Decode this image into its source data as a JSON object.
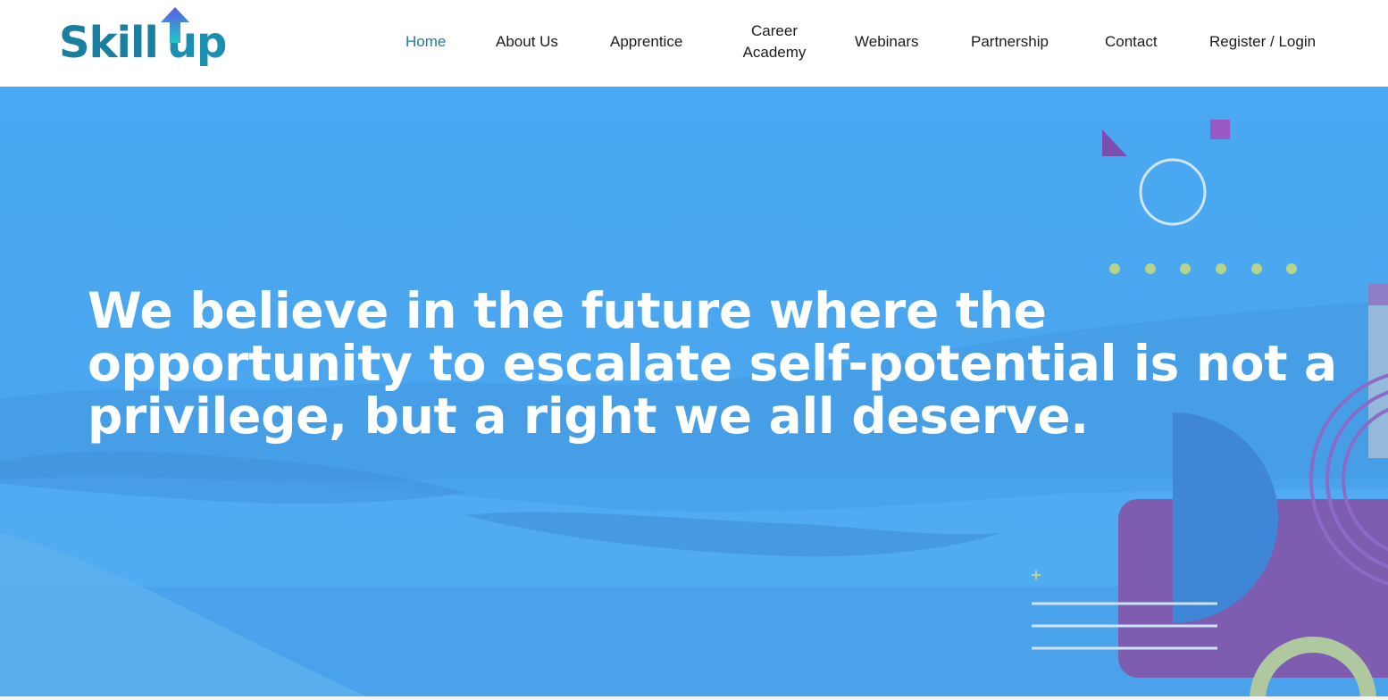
{
  "header": {
    "logo": {
      "text_left": "Skill",
      "text_right": "up"
    },
    "nav": [
      {
        "label": "Home"
      },
      {
        "label": "About Us"
      },
      {
        "label": "Apprentice"
      },
      {
        "label": "Career",
        "label2": "Academy"
      },
      {
        "label": "Webinars"
      },
      {
        "label": "Partnership"
      },
      {
        "label": "Contact"
      },
      {
        "label": "Register / Login"
      }
    ]
  },
  "hero": {
    "headline_line1": "We believe in the future where the",
    "headline_line2": "opportunity to escalate self-potential is not a",
    "headline_line3": "privilege, but a right we all deserve."
  },
  "colors": {
    "brand_teal": "#1a7f9e",
    "arrow_purple": "#5b5ce6",
    "hero_blue": "#4aa6ef",
    "nav_active": "#1f7f96",
    "deco_purple": "#7b4fb0",
    "deco_dots": "#b7d48a"
  },
  "icons": [
    "up-arrow-icon",
    "plus-icon"
  ]
}
